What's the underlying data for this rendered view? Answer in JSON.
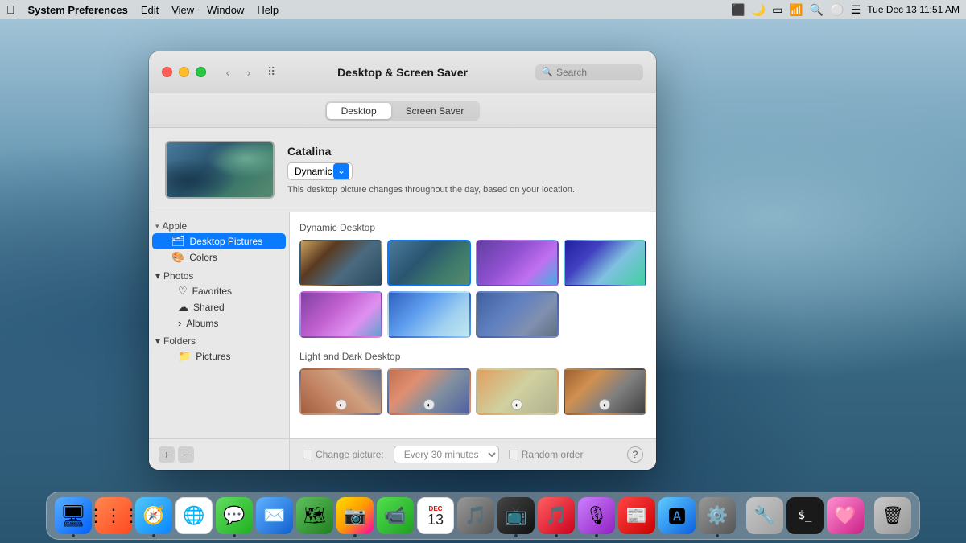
{
  "menubar": {
    "app_name": "System Preferences",
    "menu_items": [
      "Edit",
      "View",
      "Window",
      "Help"
    ],
    "time": "Tue Dec 13  11:51 AM"
  },
  "window": {
    "title": "Desktop & Screen Saver",
    "search_placeholder": "Search"
  },
  "tabs": {
    "desktop_label": "Desktop",
    "screensaver_label": "Screen Saver"
  },
  "preview": {
    "title": "Catalina",
    "dropdown_value": "Dynamic",
    "description": "This desktop picture changes throughout the day, based on your location."
  },
  "sidebar": {
    "apple_label": "Apple",
    "desktop_pictures_label": "Desktop Pictures",
    "colors_label": "Colors",
    "photos_label": "Photos",
    "favorites_label": "Favorites",
    "shared_label": "Shared",
    "albums_label": "Albums",
    "folders_label": "Folders",
    "pictures_label": "Pictures"
  },
  "main": {
    "section1_label": "Dynamic Desktop",
    "section2_label": "Light and Dark Desktop"
  },
  "options": {
    "change_picture_label": "Change picture:",
    "interval_label": "Every 30 minutes",
    "random_label": "Random order",
    "help_label": "?"
  },
  "dock": {
    "items": [
      {
        "name": "Finder",
        "icon": "🔵"
      },
      {
        "name": "Launchpad",
        "icon": "🚀"
      },
      {
        "name": "Safari",
        "icon": "🧭"
      },
      {
        "name": "Chrome",
        "icon": "🌐"
      },
      {
        "name": "Messages",
        "icon": "💬"
      },
      {
        "name": "Mail",
        "icon": "✉️"
      },
      {
        "name": "Maps",
        "icon": "🗺️"
      },
      {
        "name": "Photos",
        "icon": "📷"
      },
      {
        "name": "FaceTime",
        "icon": "📹"
      },
      {
        "name": "Calendar",
        "icon": "📅"
      },
      {
        "name": "AppStore",
        "icon": "🛍️"
      },
      {
        "name": "TV",
        "icon": "📺"
      },
      {
        "name": "Music",
        "icon": "🎵"
      },
      {
        "name": "Podcasts",
        "icon": "🎙️"
      },
      {
        "name": "News",
        "icon": "📰"
      },
      {
        "name": "AppStore2",
        "icon": "🔷"
      },
      {
        "name": "SysPrefs",
        "icon": "⚙️"
      },
      {
        "name": "Utilities",
        "icon": "🔧"
      },
      {
        "name": "Terminal",
        "icon": "⬛"
      },
      {
        "name": "CleanMyMac",
        "icon": "🩷"
      },
      {
        "name": "Trash",
        "icon": "🗑️"
      }
    ]
  }
}
